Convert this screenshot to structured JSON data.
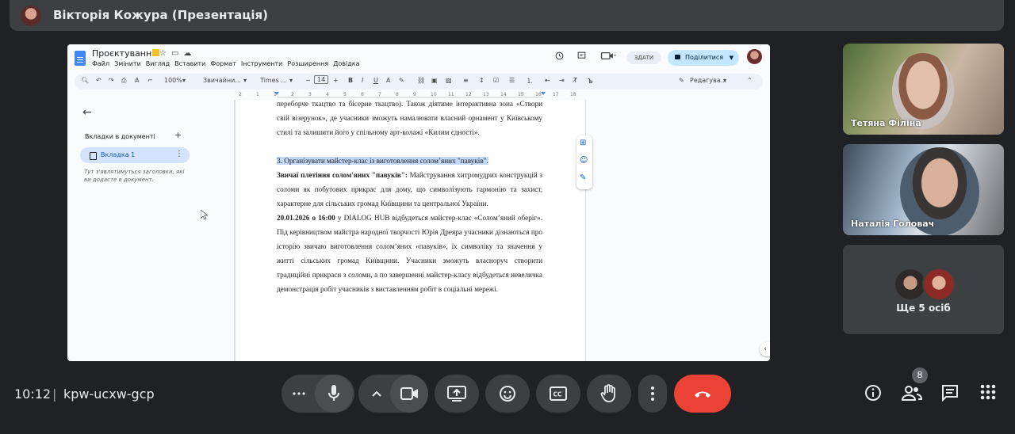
{
  "presenter": {
    "title": "Вікторія Кожура (Презентація)"
  },
  "doc": {
    "title": "Проєктування",
    "menu": [
      "Файл",
      "Змінити",
      "Вигляд",
      "Вставити",
      "Формат",
      "Інструменти",
      "Розширення",
      "Довідка"
    ],
    "edit_label": "ЗДАТИ",
    "share_label": "Поділитися",
    "toolbar": {
      "zoom": "100%",
      "style": "Звичайни...",
      "font": "Times ...",
      "font_size": "14",
      "mode": "Редагува..."
    },
    "ruler_marks": [
      "2",
      "1",
      "1",
      "2",
      "3",
      "4",
      "5",
      "6",
      "7",
      "8",
      "9",
      "10",
      "11",
      "12",
      "13",
      "14",
      "15",
      "16",
      "17",
      "18"
    ],
    "sidebar": {
      "tabs_title": "Вкладки в документі",
      "tab_label": "Вкладка 1",
      "hint": "Тут з'являтимуться заголовки, які ви додасте в документ."
    },
    "paragraphs": [
      "переборче ткацтво та бісерне ткацтво). Також діятиме інтерактивна зона «Створи свій візерунок», де учасники зможуть намалювати власний орнамент у Київському стилі та залишити його у спільному арт-колажі «Килим єдності».",
      "3. Організувати майстер-клас із виготовлення солом’яних \"павуків\".",
      "Звичаї плетіння солом'яних \"павуків\":",
      " Майстрування хитромудрих конструкцій з соломи як побутових прикрас для дому, що символізують гармонію та захист, характерне для сільських громад Київщини та центральної України.",
      "20.01.2026 о 16:00",
      " у DIALOG HUB відбудеться майстер-клас «Солом’яний оберіг». Під керівництвом майстра народної творчості Юрія Дреяра учасники дізнаються про історію звичаю виготовлення солом’яних «павуків», їх символіку та значення у житті сільських громад Київщини. Учасники зможуть власноруч створити традиційні прикраси з соломи, а по завершенні майстер-класу відбудеться невеличка демонстрація робіт учасників з виставленням робіт в соціальні мережі."
    ]
  },
  "participants": [
    {
      "name": "Тетяна Філіна"
    },
    {
      "name": "Наталія Головач"
    }
  ],
  "more_people": "Ще 5 осіб",
  "bottom": {
    "time": "10:12",
    "separator": "|",
    "meeting_code": "kpw-ucxw-gcp",
    "participant_count": "8"
  },
  "colors": {
    "end_call": "#ea4335",
    "share_button": "#c2e7ff",
    "selection": "#c3d7f7"
  }
}
